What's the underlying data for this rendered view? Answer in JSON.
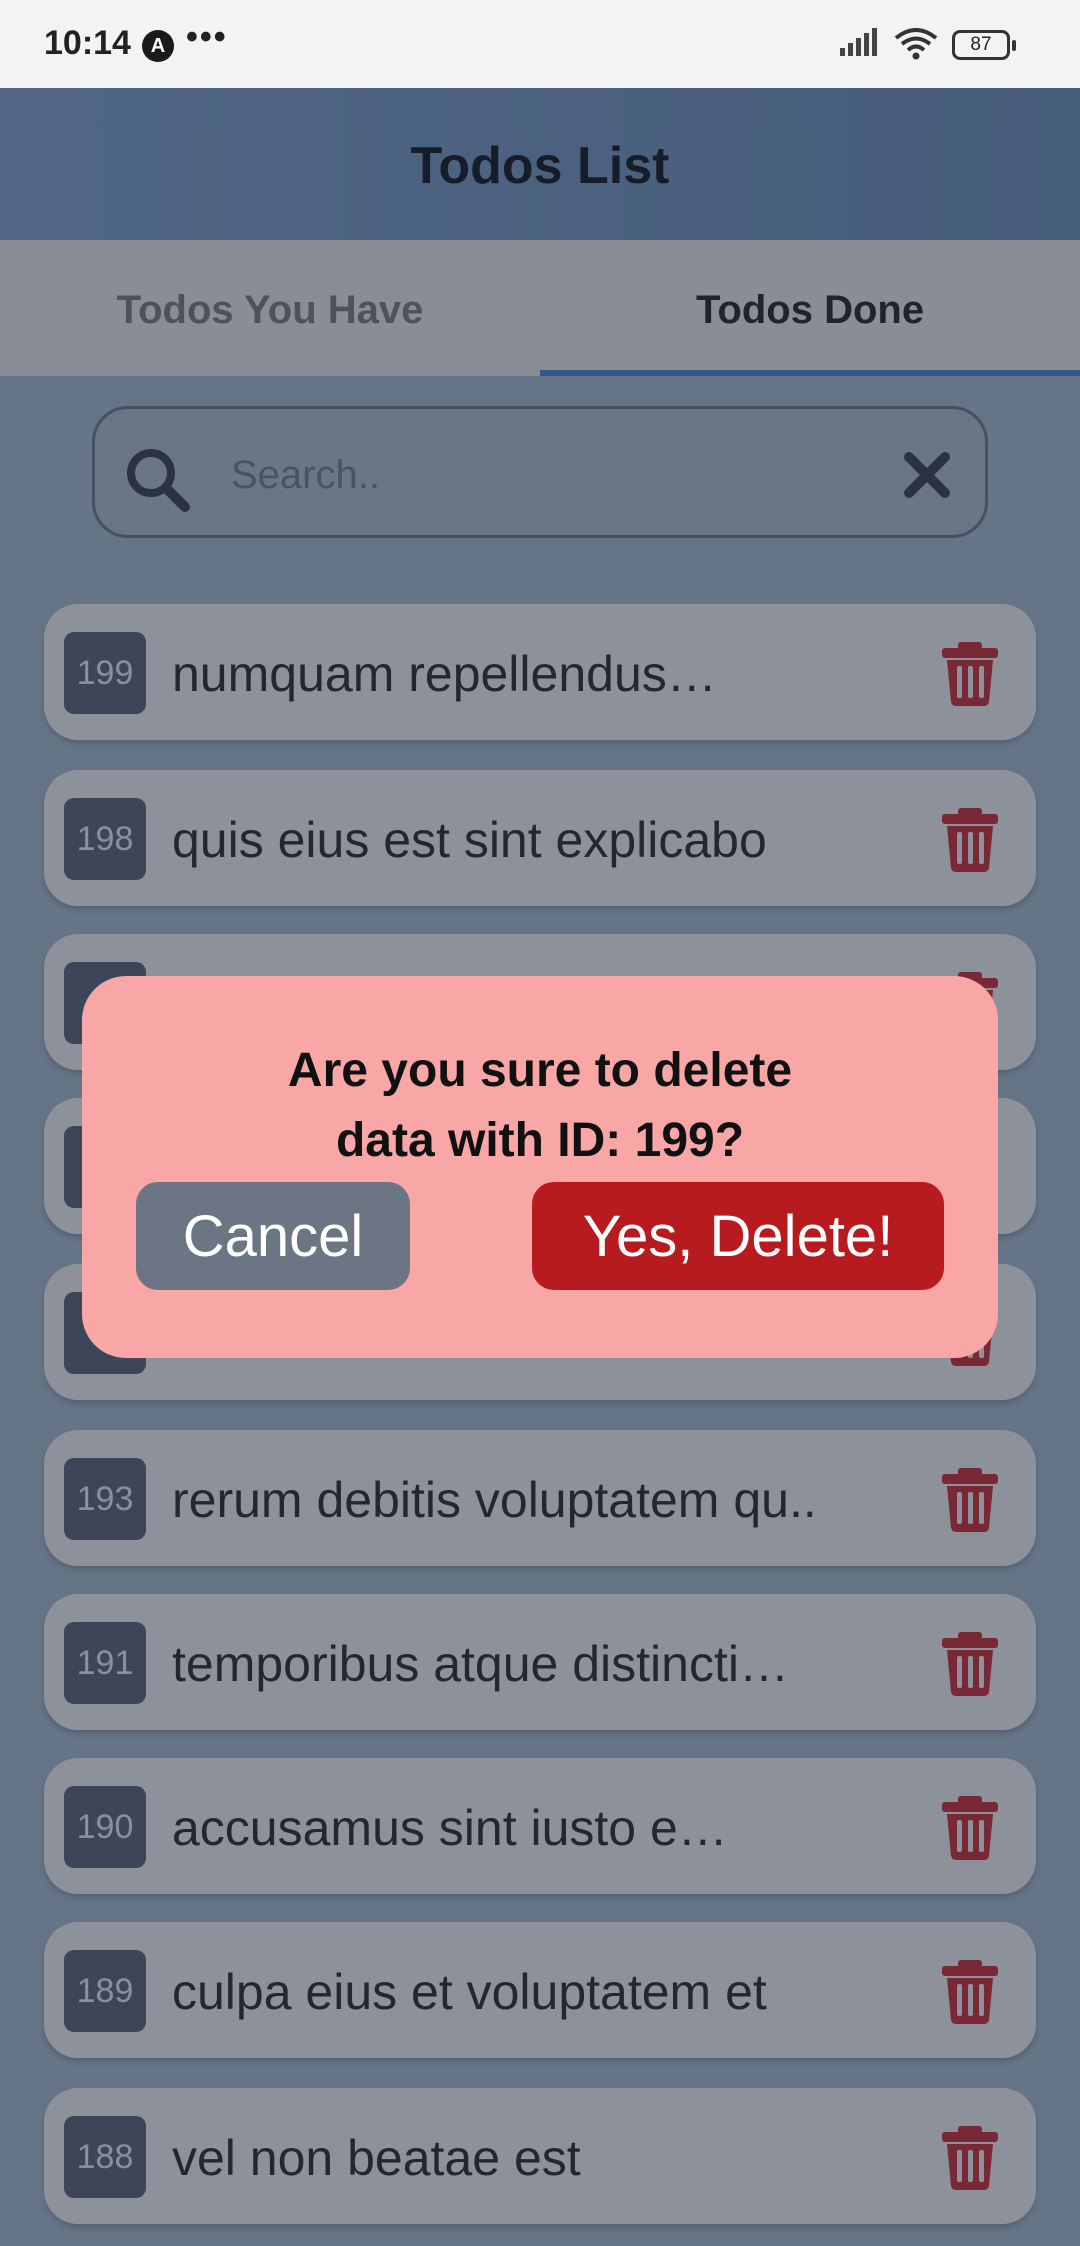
{
  "status_bar": {
    "time": "10:14",
    "app_icon_letter": "A",
    "more": "•••",
    "battery": "87"
  },
  "app_bar": {
    "title": "Todos List"
  },
  "tabs": [
    {
      "label": "Todos You Have",
      "active": false
    },
    {
      "label": "Todos Done",
      "active": true
    }
  ],
  "search": {
    "placeholder": "Search..",
    "value": ""
  },
  "todos": [
    {
      "id": "199",
      "title": "numquam repellendus…"
    },
    {
      "id": "198",
      "title": "quis eius est sint explicabo"
    },
    {
      "id": "",
      "title": ""
    },
    {
      "id": "",
      "title": ""
    },
    {
      "id": "",
      "title": ""
    },
    {
      "id": "193",
      "title": "rerum debitis voluptatem qu.."
    },
    {
      "id": "191",
      "title": "temporibus atque distincti…"
    },
    {
      "id": "190",
      "title": "accusamus sint iusto e…"
    },
    {
      "id": "189",
      "title": "culpa eius et voluptatem et"
    },
    {
      "id": "188",
      "title": "vel non beatae est"
    }
  ],
  "dialog": {
    "line1": "Are you sure to delete",
    "line2": "data with ID: 199?",
    "cancel_label": "Cancel",
    "confirm_label": "Yes, Delete!"
  },
  "colors": {
    "app_bar": "#6e8db3",
    "tab_indicator": "#3e6fbd",
    "delete_button": "#b71b1f",
    "cancel_button": "#6b7584",
    "dialog_bg": "#f8a6a6",
    "trash_icon": "#b1242a"
  },
  "icons": [
    "search-icon",
    "close-icon",
    "trash-icon",
    "signal-icon",
    "wifi-icon",
    "battery-icon"
  ]
}
